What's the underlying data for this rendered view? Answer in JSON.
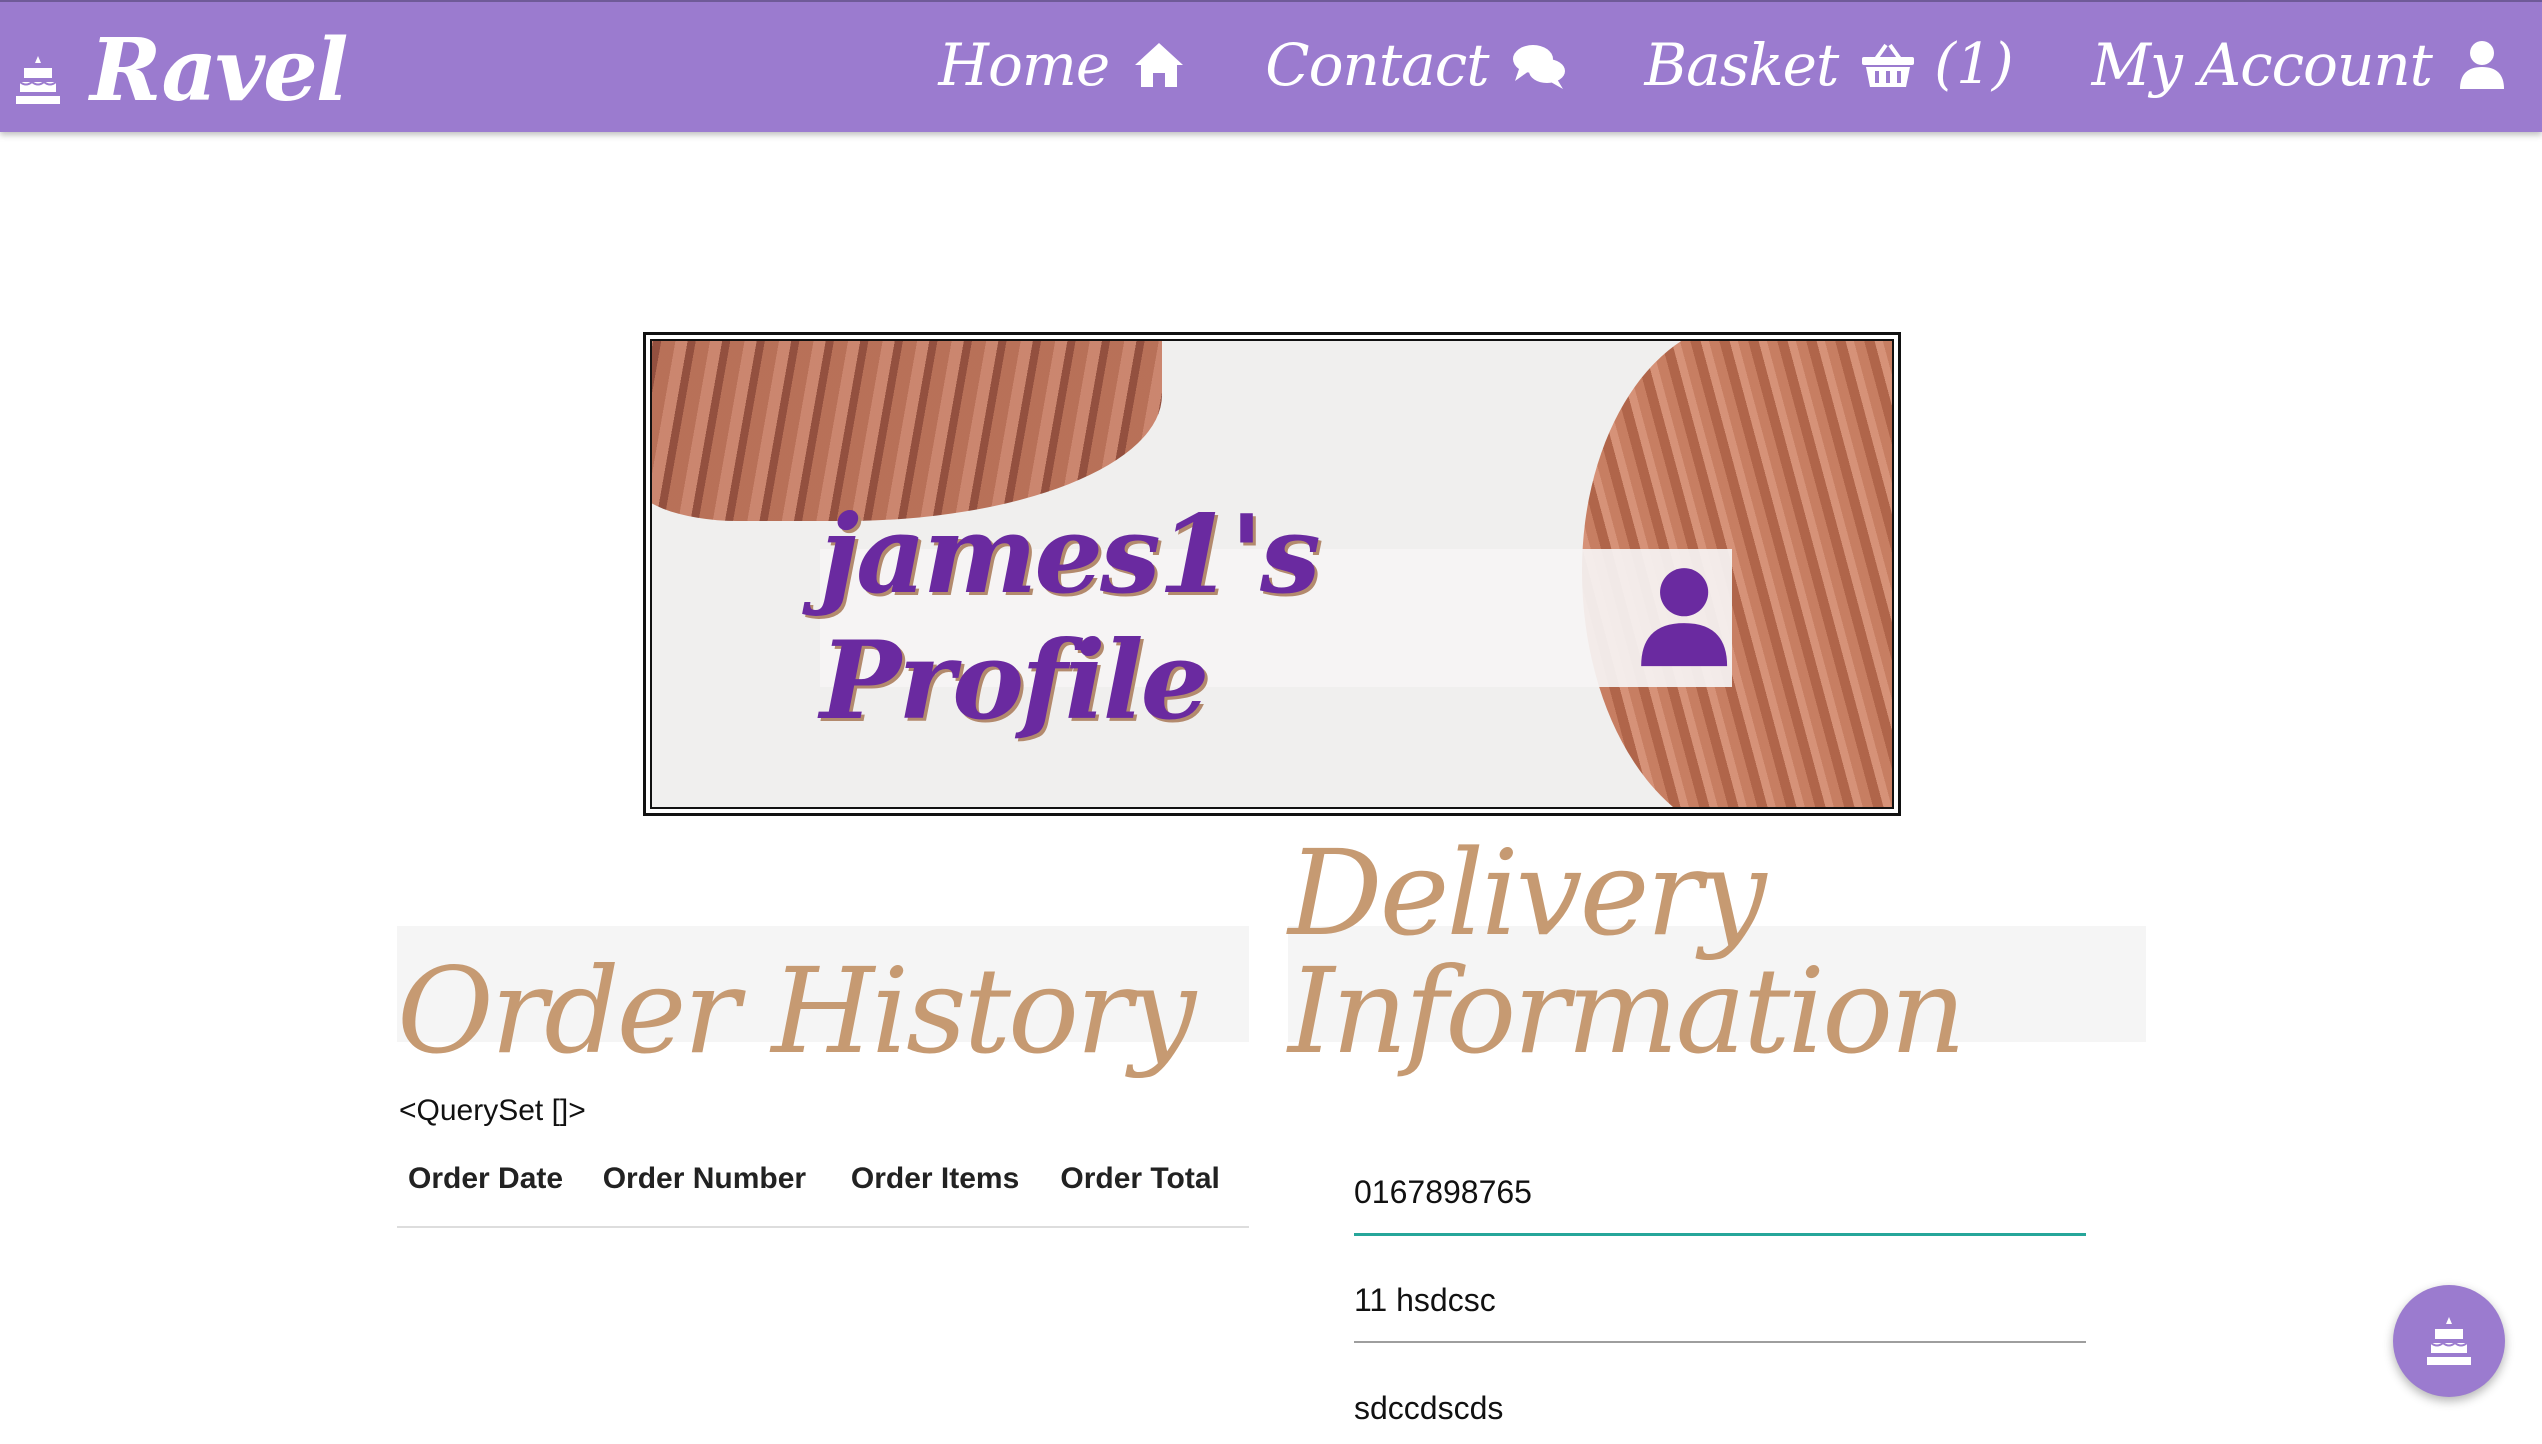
{
  "brand": {
    "name": "Ravel",
    "icon": "cake-icon"
  },
  "nav": {
    "home": "Home",
    "contact": "Contact",
    "basket": "Basket",
    "basket_count": "(1)",
    "account": "My Account"
  },
  "hero": {
    "title": "james1's Profile",
    "icon": "user-icon"
  },
  "order_history": {
    "heading": "Order History",
    "queryset": "<QuerySet []>",
    "columns": [
      "Order Date",
      "Order Number",
      "Order Items",
      "Order Total"
    ]
  },
  "delivery": {
    "heading": "Delivery Information",
    "phone": "0167898765",
    "address1": "11 hsdcsc",
    "address2": "sdccdscds"
  },
  "colors": {
    "navbar": "#9b7bcf",
    "heading": "#c69a72",
    "hero_title": "#6a2aa0",
    "active_field": "#26a69a"
  }
}
